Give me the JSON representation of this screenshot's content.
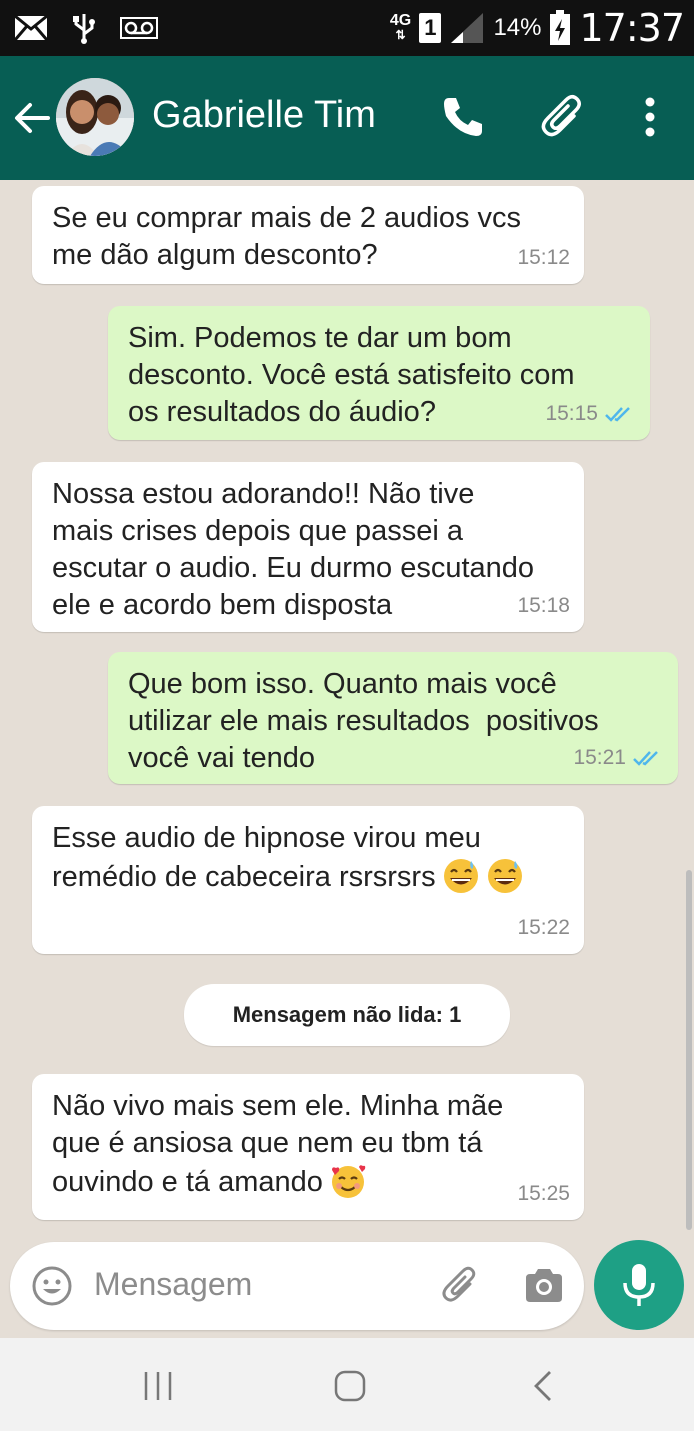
{
  "status_bar": {
    "network": "4G",
    "sim": "1",
    "battery": "14%",
    "time": "17:37"
  },
  "header": {
    "contact_name": "Gabrielle Tim"
  },
  "messages": [
    {
      "direction": "in",
      "text": "Se eu comprar mais de 2 audios vcs\nme dão algum desconto?",
      "time": "15:12"
    },
    {
      "direction": "out",
      "text": "Sim. Podemos te dar um bom\ndesconto. Você está satisfeito com\nos resultados do áudio?",
      "time": "15:15"
    },
    {
      "direction": "in",
      "text": "Nossa estou adorando!! Não tive\nmais crises depois que passei a\nescutar o audio. Eu durmo escutando\nele e acordo bem disposta",
      "time": "15:18"
    },
    {
      "direction": "out",
      "text": "Que bom isso. Quanto mais você\nutilizar ele mais resultados  positivos\nvocê vai tendo",
      "time": "15:21"
    },
    {
      "direction": "in",
      "text": "Esse audio de hipnose virou meu\nremédio de cabeceira rsrsrsrs",
      "time": "15:22",
      "emojis": [
        "grinning-sweat-emoji",
        "grinning-sweat-emoji"
      ]
    },
    {
      "direction": "in",
      "text": "Não vivo mais sem ele. Minha mãe\nque é ansiosa que nem eu tbm tá\nouvindo e tá amando",
      "time": "15:25",
      "emojis": [
        "smiling-face-with-hearts-emoji"
      ]
    }
  ],
  "unread_banner": "Mensagem não lida: 1",
  "input": {
    "placeholder": "Mensagem"
  },
  "colors": {
    "header": "#075e54",
    "outgoing_bubble": "#dcf8c6",
    "incoming_bubble": "#ffffff",
    "chat_background": "#e5ded6",
    "mic_button": "#1ea085",
    "read_ticks": "#4fb6ec"
  },
  "icons": [
    "mail-icon",
    "usb-icon",
    "voicemail-icon",
    "signal-icon",
    "battery-icon",
    "back-arrow-icon",
    "phone-icon",
    "paperclip-icon",
    "more-vert-icon",
    "emoji-icon",
    "camera-icon",
    "mic-icon",
    "recents-icon",
    "home-icon",
    "nav-back-icon"
  ]
}
